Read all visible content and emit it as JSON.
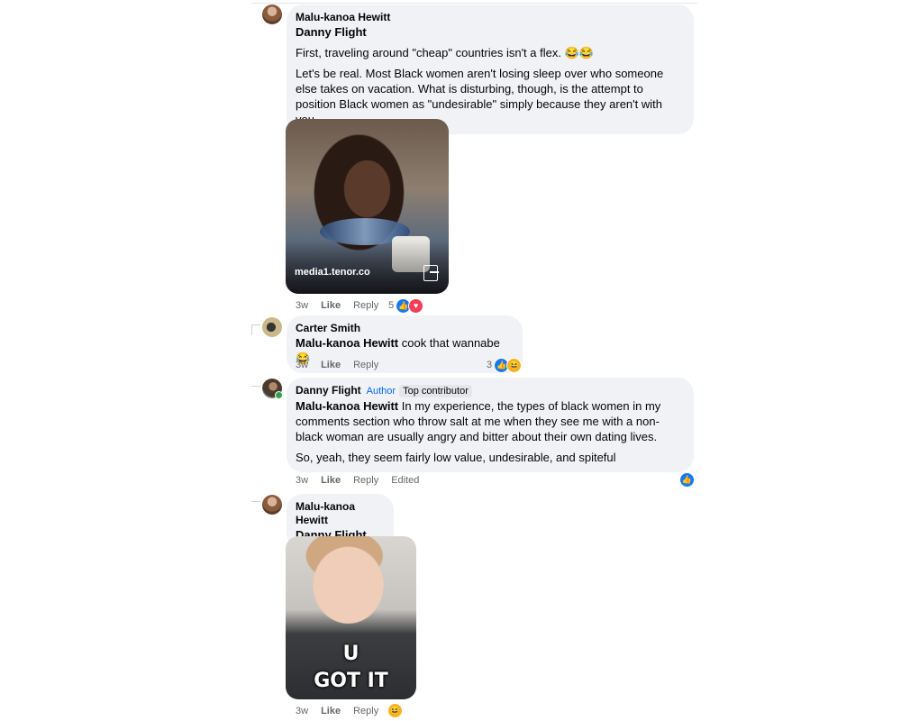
{
  "comments": [
    {
      "header": "Malu-kanoa Hewitt",
      "mention": "Danny Flight",
      "paragraphs": [
        "First, traveling around \"cheap\" countries isn't a flex. 😂😂",
        "Let's be real. Most Black women aren't losing sleep over who someone else takes on vacation. What is disturbing, though, is the attempt to position Black women as \"undesirable\" simply because they aren't with you."
      ],
      "gif_source": "media1.tenor.co",
      "time": "3w",
      "like_label": "Like",
      "reply_label": "Reply",
      "reaction_count": "5",
      "reactions": [
        "like-icon",
        "love-icon"
      ]
    },
    {
      "header": "Carter Smith",
      "mention": "Malu-kanoa Hewitt",
      "text": " cook that wannabe 😂",
      "time": "3w",
      "like_label": "Like",
      "reply_label": "Reply",
      "reaction_count": "3",
      "reactions": [
        "like-icon",
        "haha-icon"
      ]
    },
    {
      "header": "Danny Flight",
      "author_badge": "Author",
      "top_badge": "Top contributor",
      "mention": "Malu-kanoa Hewitt",
      "text": " In my experience, the types of black women in my comments section who throw salt at me when they see me with a non-black woman are usually angry and bitter about their own dating lives.",
      "paragraph2": "So, yeah, they seem fairly low value, undesirable, and spiteful",
      "time": "3w",
      "like_label": "Like",
      "reply_label": "Reply",
      "edited_label": "Edited",
      "reactions": [
        "like-icon"
      ]
    },
    {
      "header": "Malu-kanoa Hewitt",
      "mention": "Danny Flight",
      "gif_caption_line1": "U",
      "gif_caption_line2": "GOT IT",
      "time": "3w",
      "like_label": "Like",
      "reply_label": "Reply",
      "reactions": [
        "haha-icon"
      ]
    }
  ],
  "colors": {
    "bubble": "#f0f2f5",
    "link_blue": "#0866ff",
    "meta_gray": "#65676b",
    "like_blue": "#1877f2",
    "love_red": "#f33e58",
    "haha_yellow": "#f7b125"
  }
}
